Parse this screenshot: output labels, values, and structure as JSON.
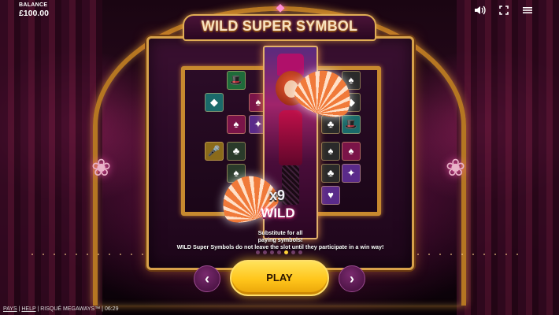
{
  "hud": {
    "balance_label": "BALANCE",
    "balance_value": "£100.00",
    "icons": [
      "speaker-icon",
      "fullscreen-icon",
      "menu-icon"
    ]
  },
  "panel": {
    "title": "WILD SUPER SYMBOL",
    "multiplier": "x9",
    "wild_label": "WILD",
    "description_line1": "Substitute for all",
    "description_line2": "paying symbols!",
    "description_line3": "WILD Super Symbols do not leave the slot until they participate in a win way!",
    "page_count": 7,
    "active_page": 5
  },
  "controls": {
    "prev_glyph": "‹",
    "next_glyph": "›",
    "play_label": "PLAY"
  },
  "footer": {
    "pays": "PAYS",
    "sep1": " | ",
    "help": "HELP",
    "sep2": " | ",
    "game_name": "RISQUÉ MEGAWAYS™",
    "sep3": " | ",
    "time": "06:29"
  },
  "colors": {
    "accent_gold": "#d7a14a",
    "play_yellow": "#ffc51a",
    "panel_purple": "#2a0a26"
  }
}
